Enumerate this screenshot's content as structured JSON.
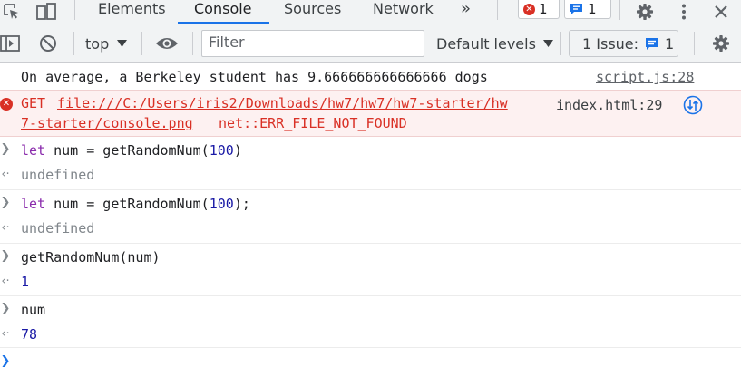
{
  "tabs": {
    "items": [
      "Elements",
      "Console",
      "Sources",
      "Network"
    ],
    "overflow": "»",
    "error_count": "1",
    "message_count": "1"
  },
  "toolbar": {
    "context": "top",
    "filter_placeholder": "Filter",
    "levels": "Default levels",
    "issues_label": "1 Issue:",
    "issues_count": "1"
  },
  "console": {
    "log": {
      "text": "On average, a Berkeley student has 9.666666666666666 dogs",
      "source": "script.js:28"
    },
    "error": {
      "method": "GET",
      "url_line1": "file:///C:/Users/iris2/Downloads/hw7/hw7/hw7-starter/hw",
      "url_line2": "7-starter/console.png",
      "status": "net::ERR_FILE_NOT_FOUND",
      "source": "index.html:29"
    },
    "entries": [
      {
        "kw": "let",
        "code": " num = getRandomNum(",
        "arg": "100",
        "tail": ")",
        "result": "undefined"
      },
      {
        "kw": "let",
        "code": " num = getRandomNum(",
        "arg": "100",
        "tail": ");",
        "result": "undefined"
      },
      {
        "kw": "",
        "code": "getRandomNum(num)",
        "arg": "",
        "tail": "",
        "result": "1"
      },
      {
        "kw": "",
        "code": "num",
        "arg": "",
        "tail": "",
        "result": "78"
      }
    ]
  },
  "colors": {
    "accent": "#1a73e8",
    "error": "#d93025",
    "error_bg": "#fdf1f1",
    "keyword": "#8a2bac",
    "number": "#1a1aa6"
  }
}
